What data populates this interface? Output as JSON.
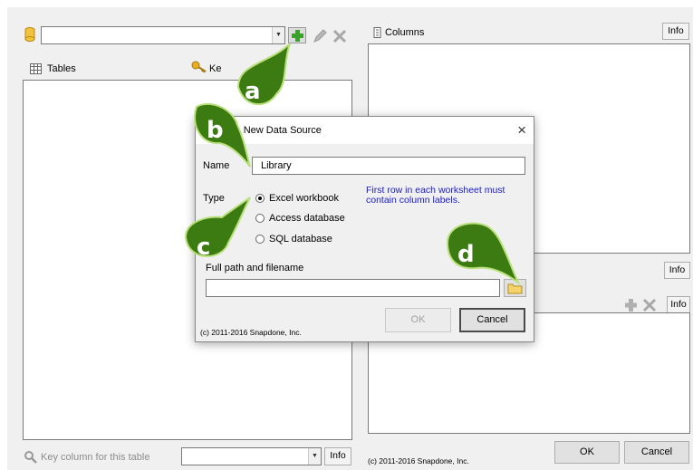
{
  "main": {
    "columns_label": "Columns",
    "tables_label": "Tables",
    "keys_label": "Ke",
    "info": "Info",
    "key_column_label": "Key column for this table",
    "copyright": "(c) 2011-2016 Snapdone, Inc.",
    "ok_label": "OK",
    "cancel_label": "Cancel"
  },
  "dialog": {
    "title": "- New Data Source",
    "close_glyph": "×",
    "name_label": "Name",
    "name_value": "Library",
    "type_label": "Type",
    "types": [
      "Excel workbook",
      "Access database",
      "SQL database"
    ],
    "selected_type": "Excel workbook",
    "hint": "First row in each worksheet must contain column labels.",
    "path_label": "Full path and filename",
    "path_value": "",
    "ok_label": "OK",
    "cancel_label": "Cancel",
    "copyright": "(c) 2011-2016 Snapdone, Inc."
  },
  "callouts": [
    "a",
    "b",
    "c",
    "d"
  ],
  "colors": {
    "callout_green": "#3c7a12",
    "hint_blue": "#1a1acc",
    "add_green": "#3aa12c"
  },
  "icons": [
    "database-icon",
    "add-icon",
    "edit-pencil-icon",
    "delete-x-icon",
    "table-grid-icon",
    "key-icon",
    "folder-icon",
    "document-icon"
  ]
}
